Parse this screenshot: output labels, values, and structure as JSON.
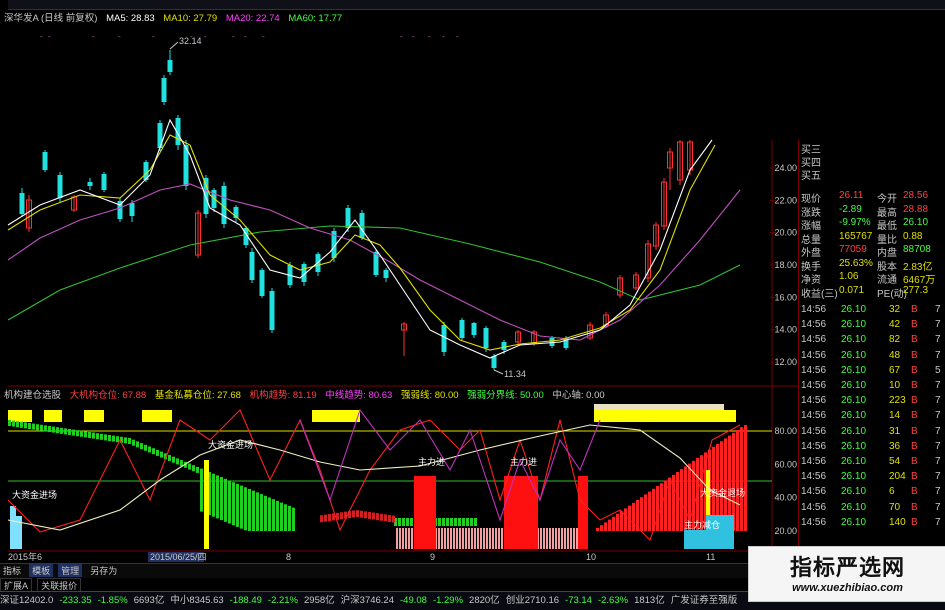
{
  "ma_legend": {
    "title": "深华发A (日线 前复权)",
    "ma5": "MA5: 28.83",
    "ma10": "MA10: 27.79",
    "ma20": "MA20: 22.74",
    "ma60": "MA60: 17.77"
  },
  "price_axis": [
    "24.00",
    "22.00",
    "20.00",
    "18.00",
    "16.00",
    "14.00",
    "12.00"
  ],
  "high_label": "32.14",
  "low_label": "11.34",
  "indicator_legend": {
    "a": "机构建仓选股",
    "b": "大机构仓位: 67.88",
    "c": "基金私募仓位: 27.68",
    "d": "机构趋势: 81.19",
    "e": "中线趋势: 80.63",
    "f": "强弱线: 80.00",
    "g": "强弱分界线: 50.00",
    "h": "中心轴: 0.00"
  },
  "ind_axis": [
    "80.00",
    "60.00",
    "40.00",
    "20.00"
  ],
  "annotations": {
    "big_in_1": "大资金进场",
    "big_in_2": "大资金进场",
    "main_in_1": "主力进",
    "main_in_2": "主力进",
    "big_out": "大资金退场",
    "main_out": "主力减仓"
  },
  "date_axis": {
    "a": "2015年6",
    "b": "2015/06/25/四",
    "c": "8",
    "d": "9",
    "e": "10",
    "f": "11"
  },
  "quote": {
    "asks": [
      "买三",
      "买四",
      "买五"
    ],
    "rows": [
      {
        "l": "现价",
        "v": "26.11",
        "l2": "今开",
        "v2": "28.56",
        "c": "#ff4040",
        "c2": "#ff4040"
      },
      {
        "l": "涨跌",
        "v": "-2.89",
        "l2": "最高",
        "v2": "28.88",
        "c": "#40ff40",
        "c2": "#ff4040"
      },
      {
        "l": "涨幅",
        "v": "-9.97%",
        "l2": "最低",
        "v2": "26.10",
        "c": "#40ff40",
        "c2": "#40ff40"
      },
      {
        "l": "总量",
        "v": "165767",
        "l2": "量比",
        "v2": "0.88",
        "c": "#e0e000",
        "c2": "#e0e000"
      },
      {
        "l": "外盘",
        "v": "77059",
        "l2": "内盘",
        "v2": "88708",
        "c": "#ff4040",
        "c2": "#40ff40"
      },
      {
        "l": "换手",
        "v": "25.63%",
        "l2": "股本",
        "v2": "2.83亿",
        "c": "#e0e000",
        "c2": "#e0e000"
      },
      {
        "l": "净资",
        "v": "1.06",
        "l2": "流通",
        "v2": "6467万",
        "c": "#e0e000",
        "c2": "#e0e000"
      },
      {
        "l": "收益(三)",
        "v": "0.071",
        "l2": "PE(动)",
        "v2": "277.3",
        "c": "#e0e000",
        "c2": "#e0e000"
      }
    ],
    "ticks": [
      {
        "t": "14:56",
        "p": "26.10",
        "v": "32",
        "s": "B",
        "n": "7"
      },
      {
        "t": "14:56",
        "p": "26.10",
        "v": "42",
        "s": "B",
        "n": "7"
      },
      {
        "t": "14:56",
        "p": "26.10",
        "v": "82",
        "s": "B",
        "n": "7"
      },
      {
        "t": "14:56",
        "p": "26.10",
        "v": "48",
        "s": "B",
        "n": "7"
      },
      {
        "t": "14:56",
        "p": "26.10",
        "v": "67",
        "s": "B",
        "n": "5"
      },
      {
        "t": "14:56",
        "p": "26.10",
        "v": "10",
        "s": "B",
        "n": "7"
      },
      {
        "t": "14:56",
        "p": "26.10",
        "v": "223",
        "s": "B",
        "n": "7"
      },
      {
        "t": "14:56",
        "p": "26.10",
        "v": "14",
        "s": "B",
        "n": "7"
      },
      {
        "t": "14:56",
        "p": "26.10",
        "v": "31",
        "s": "B",
        "n": "7"
      },
      {
        "t": "14:56",
        "p": "26.10",
        "v": "36",
        "s": "B",
        "n": "7"
      },
      {
        "t": "14:56",
        "p": "26.10",
        "v": "54",
        "s": "B",
        "n": "7"
      },
      {
        "t": "14:56",
        "p": "26.10",
        "v": "204",
        "s": "B",
        "n": "7"
      },
      {
        "t": "14:56",
        "p": "26.10",
        "v": "6",
        "s": "B",
        "n": "7"
      },
      {
        "t": "14:56",
        "p": "26.10",
        "v": "70",
        "s": "B",
        "n": "7"
      },
      {
        "t": "14:56",
        "p": "26.10",
        "v": "140",
        "s": "B",
        "n": "7"
      }
    ]
  },
  "toolbar": [
    "指标",
    "模板",
    "管理",
    "另存为"
  ],
  "tabs2": [
    "扩展A",
    "关联报价"
  ],
  "status": [
    {
      "t": "深证12402.0",
      "c": "#c8c8c8"
    },
    {
      "t": "-233.35",
      "c": "#40ff40"
    },
    {
      "t": "-1.85%",
      "c": "#40ff40"
    },
    {
      "t": "6693亿",
      "c": "#c8c8c8"
    },
    {
      "t": "中小8345.63",
      "c": "#c8c8c8"
    },
    {
      "t": "-188.49",
      "c": "#40ff40"
    },
    {
      "t": "-2.21%",
      "c": "#40ff40"
    },
    {
      "t": "2958亿",
      "c": "#c8c8c8"
    },
    {
      "t": "沪深3746.24",
      "c": "#c8c8c8"
    },
    {
      "t": "-49.08",
      "c": "#40ff40"
    },
    {
      "t": "-1.29%",
      "c": "#40ff40"
    },
    {
      "t": "2820亿",
      "c": "#c8c8c8"
    },
    {
      "t": "创业2710.16",
      "c": "#c8c8c8"
    },
    {
      "t": "-73.14",
      "c": "#40ff40"
    },
    {
      "t": "-2.63%",
      "c": "#40ff40"
    },
    {
      "t": "1813亿",
      "c": "#c8c8c8"
    },
    {
      "t": "广发证券至强版",
      "c": "#c8c8c8"
    }
  ],
  "watermark": {
    "title": "指标严选网",
    "url": "www.xuezhibiao.com"
  },
  "colors": {
    "up": "#ff3030",
    "down": "#20e0e0",
    "ma5": "#ffffff",
    "ma10": "#e0e000",
    "ma20": "#c050c0",
    "ma60": "#30c030"
  }
}
